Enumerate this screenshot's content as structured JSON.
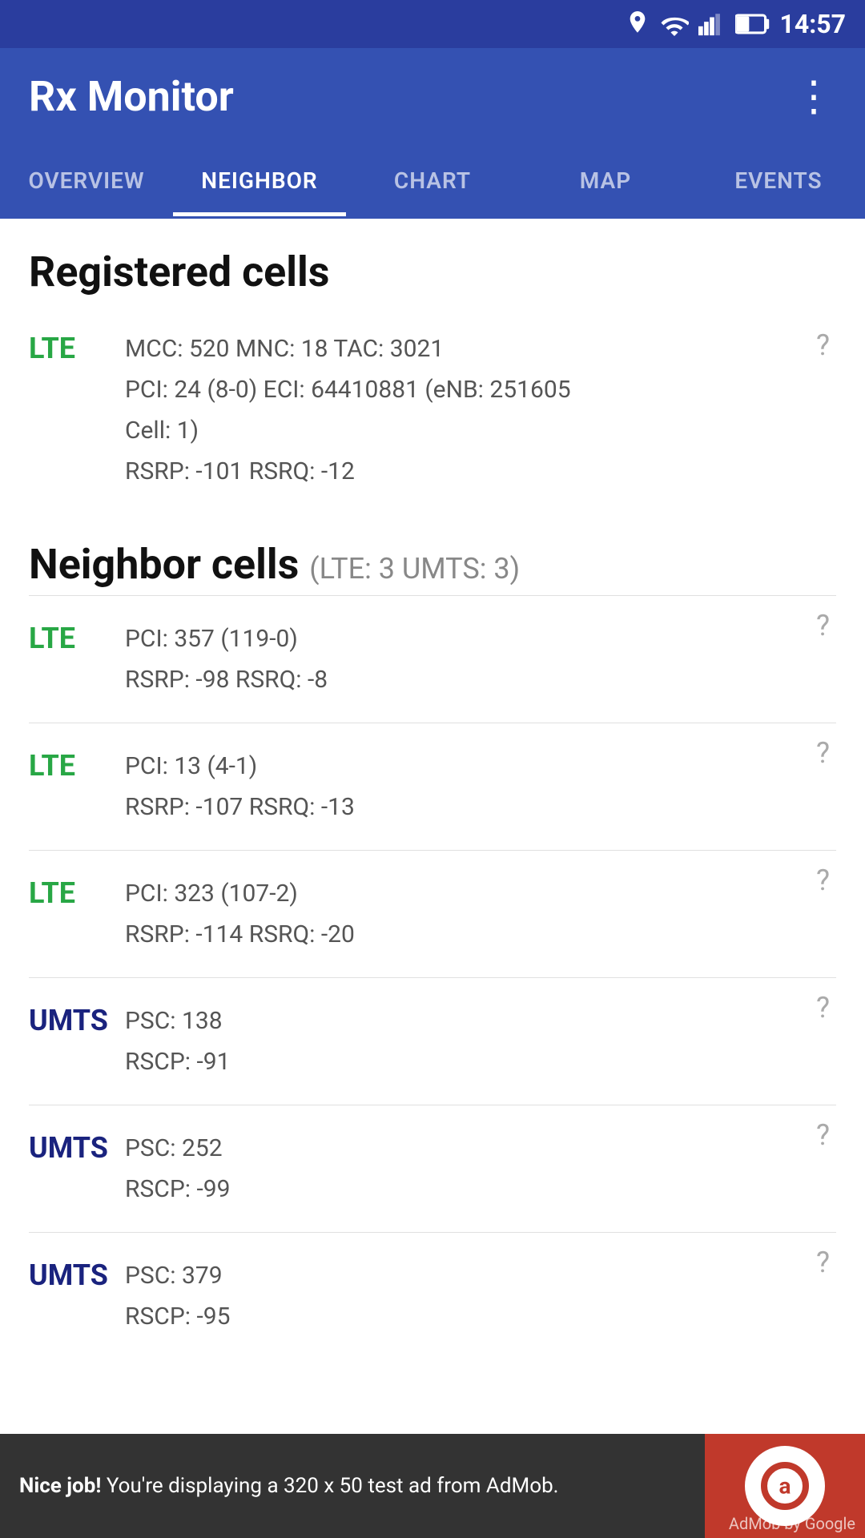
{
  "statusBar": {
    "time": "14:57"
  },
  "appBar": {
    "title": "Rx Monitor",
    "menuIcon": "⋮"
  },
  "tabs": [
    {
      "id": "overview",
      "label": "OVERVIEW",
      "active": false
    },
    {
      "id": "neighbor",
      "label": "NEIGHBOR",
      "active": true
    },
    {
      "id": "chart",
      "label": "CHART",
      "active": false
    },
    {
      "id": "map",
      "label": "MAP",
      "active": false
    },
    {
      "id": "events",
      "label": "EVENTS",
      "active": false
    }
  ],
  "registeredSection": {
    "title": "Registered cells",
    "cell": {
      "tech": "LTE",
      "techClass": "lte",
      "line1": "MCC: 520  MNC: 18  TAC: 3021",
      "line2": "PCI: 24 (8-0)  ECI: 64410881 (eNB: 251605",
      "line3": "Cell: 1)",
      "line4": "RSRP: -101  RSRQ: -12"
    }
  },
  "neighborSection": {
    "title": "Neighbor cells",
    "subtitle": "(LTE: 3  UMTS: 3)",
    "cells": [
      {
        "tech": "LTE",
        "techClass": "lte",
        "line1": "PCI: 357 (119-0)",
        "line2": "RSRP: -98  RSRQ: -8"
      },
      {
        "tech": "LTE",
        "techClass": "lte",
        "line1": "PCI: 13 (4-1)",
        "line2": "RSRP: -107  RSRQ: -13"
      },
      {
        "tech": "LTE",
        "techClass": "lte",
        "line1": "PCI: 323 (107-2)",
        "line2": "RSRP: -114  RSRQ: -20"
      },
      {
        "tech": "UMTS",
        "techClass": "umts",
        "line1": "PSC: 138",
        "line2": "RSCP: -91"
      },
      {
        "tech": "UMTS",
        "techClass": "umts",
        "line1": "PSC: 252",
        "line2": "RSCP: -99"
      },
      {
        "tech": "UMTS",
        "techClass": "umts",
        "line1": "PSC: 379",
        "line2": "RSCP: -95"
      }
    ]
  },
  "adBanner": {
    "niceJob": "Nice job!",
    "text": " You're displaying a 320 x 50 test ad from AdMob.",
    "admobLabel": "AdMob by Google"
  }
}
